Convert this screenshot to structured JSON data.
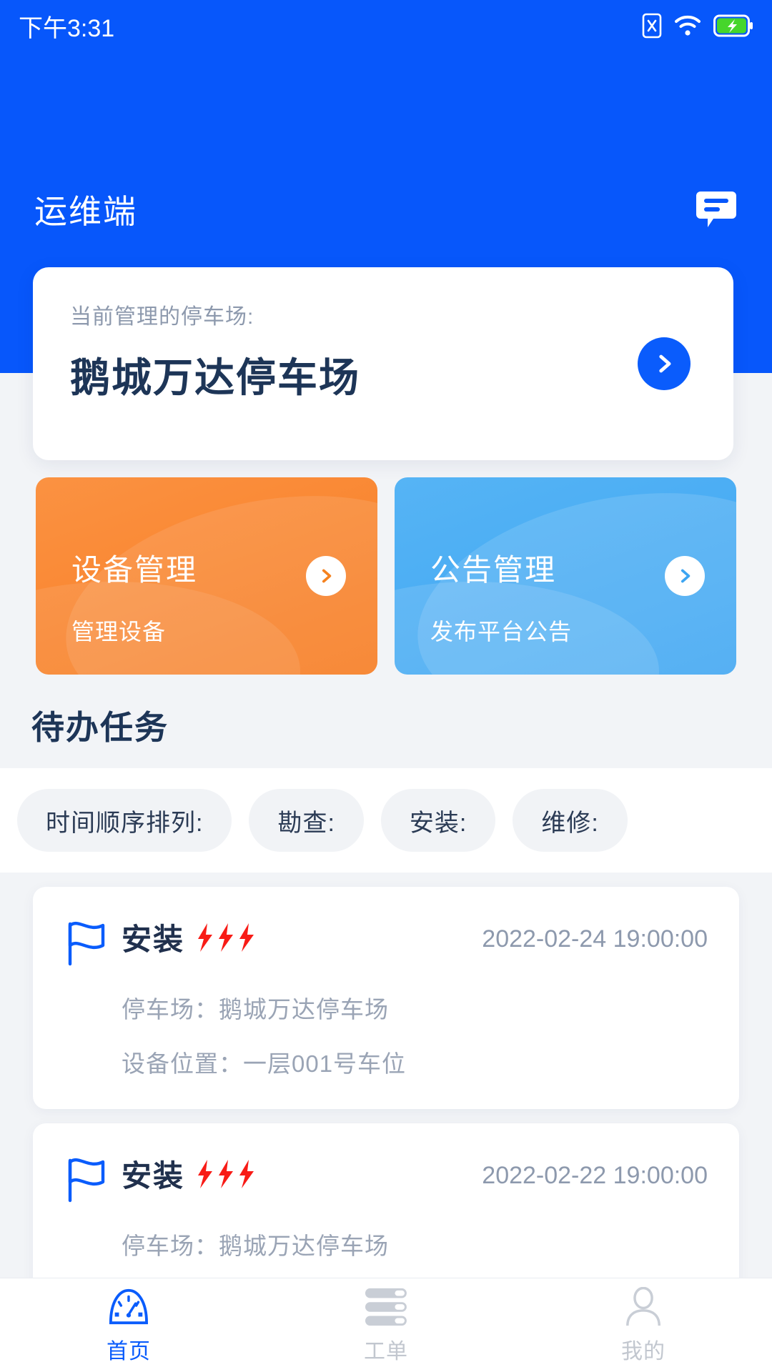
{
  "status_bar": {
    "time": "下午3:31",
    "icons": [
      "sim-x-icon",
      "wifi-icon",
      "battery-charging-icon"
    ]
  },
  "header": {
    "title": "运维端",
    "message_icon": "message-bubble-icon",
    "bg_color": "#0757fb"
  },
  "current_lot": {
    "label": "当前管理的停车场:",
    "name": "鹅城万达停车场",
    "arrow_icon": "chevron-right-icon"
  },
  "features": [
    {
      "title": "设备管理",
      "subtitle": "管理设备",
      "color": "#f5821f",
      "arrow_icon": "chevron-right-icon"
    },
    {
      "title": "公告管理",
      "subtitle": "发布平台公告",
      "color": "#3da5f2",
      "arrow_icon": "chevron-right-icon"
    }
  ],
  "tasks_section": {
    "title": "待办任务",
    "filters": [
      "时间顺序排列:",
      "勘查:",
      "安装:",
      "维修:"
    ],
    "items": [
      {
        "flag_icon": "flag-icon",
        "type": "安装",
        "priority_bolts": 3,
        "date": "2022-02-24 19:00:00",
        "lot": "停车场：鹅城万达停车场",
        "position": "设备位置：一层001号车位"
      },
      {
        "flag_icon": "flag-icon",
        "type": "安装",
        "priority_bolts": 3,
        "date": "2022-02-22 19:00:00",
        "lot": "停车场：鹅城万达停车场",
        "position": ""
      }
    ]
  },
  "tabbar": {
    "items": [
      {
        "label": "首页",
        "icon": "gauge-icon",
        "active": true
      },
      {
        "label": "工单",
        "icon": "list-icon",
        "active": false
      },
      {
        "label": "我的",
        "icon": "person-icon",
        "active": false
      }
    ],
    "active_color": "#0a5cfc",
    "inactive_color": "#c2c7cf"
  }
}
